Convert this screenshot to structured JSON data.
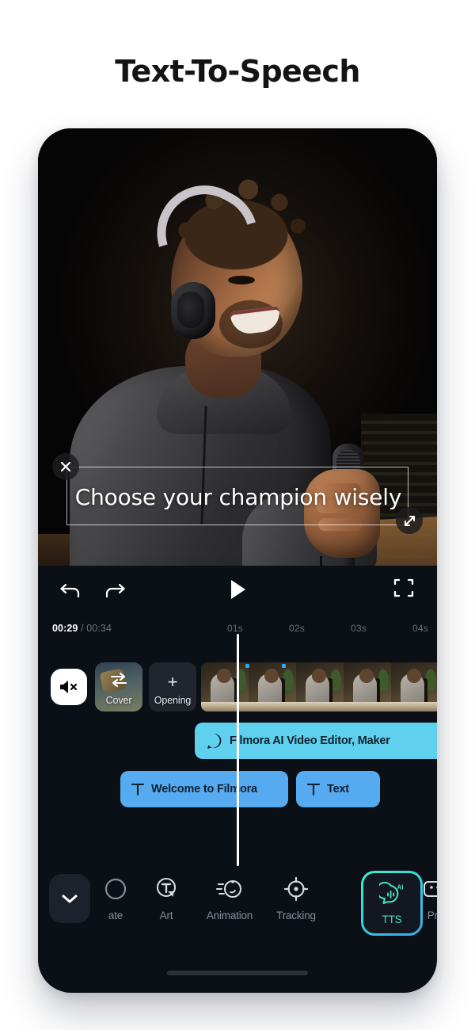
{
  "page": {
    "title": "Text-To-Speech",
    "background_color": "#ffffff"
  },
  "preview": {
    "caption_text": "Choose your champion wisely",
    "close_icon": "close-icon",
    "resize_icon": "resize-handle-icon"
  },
  "controls": {
    "undo_icon": "undo-icon",
    "redo_icon": "redo-icon",
    "play_icon": "play-icon",
    "fullscreen_icon": "fullscreen-icon"
  },
  "timeline": {
    "current_time": "00:29",
    "separator": "/",
    "total_time": "00:34",
    "ruler_ticks": [
      "01s",
      "02s",
      "03s",
      "04s"
    ],
    "mute_icon": "mute-speaker-icon",
    "chips": [
      {
        "label": "Cover",
        "icon": "transition-icon"
      },
      {
        "label": "Opening",
        "icon": "plus-icon"
      }
    ],
    "clips": [
      {
        "label": "Filmora AI Video Editor, Maker",
        "icon": "audio-wave-icon",
        "color": "#5fd0ee"
      },
      {
        "label": "Welcome to Filmora",
        "icon": "text-t-icon",
        "color": "#56aaf0"
      },
      {
        "label": "Text",
        "icon": "text-t-icon",
        "color": "#56aaf0"
      }
    ],
    "playhead_color": "#ffffff"
  },
  "toolbar": {
    "collapse_icon": "chevron-down-icon",
    "items": [
      {
        "label": "ate",
        "icon": "template-icon",
        "active": false
      },
      {
        "label": "Art",
        "icon": "art-text-icon",
        "active": false
      },
      {
        "label": "Animation",
        "icon": "animation-icon",
        "active": false
      },
      {
        "label": "Tracking",
        "icon": "tracking-target-icon",
        "active": false
      },
      {
        "label": "TTS",
        "icon": "tts-ai-icon",
        "active": true
      },
      {
        "label": "Pre",
        "icon": "preset-icon",
        "active": false
      }
    ],
    "active_color": "#46e0c0",
    "active_border_gradient": [
      "#3ef0c8",
      "#3aa8f5"
    ]
  }
}
